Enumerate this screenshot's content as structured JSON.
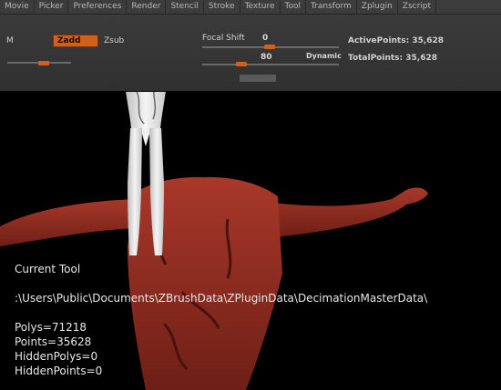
{
  "menu": {
    "items": [
      "Movie",
      "Picker",
      "Preferences",
      "Render",
      "Stencil",
      "Stroke",
      "Texture",
      "Tool",
      "Transform",
      "Zplugin",
      "Zscript"
    ]
  },
  "toolbar": {
    "m_label": "M",
    "zadd_label": "Zadd",
    "zsub_label": "Zsub",
    "focal_shift_label": "Focal Shift",
    "focal_shift_value": "0",
    "secondary_value": "80",
    "dynamic_label": "Dynamic",
    "active_points": "ActivePoints: 35,628",
    "total_points": "TotalPoints: 35,628"
  },
  "tool_info": {
    "title": "Current Tool",
    "path": ":\\Users\\Public\\Documents\\ZBrushData\\ZPluginData\\DecimationMasterData\\",
    "polys": "Polys=71218",
    "points": "Points=35628",
    "hidden_polys": "HiddenPolys=0",
    "hidden_points": "HiddenPoints=0"
  },
  "colors": {
    "accent_orange": "#d2601b",
    "model_red": "#8b2a1e",
    "figure_white": "#e8e8e8"
  }
}
